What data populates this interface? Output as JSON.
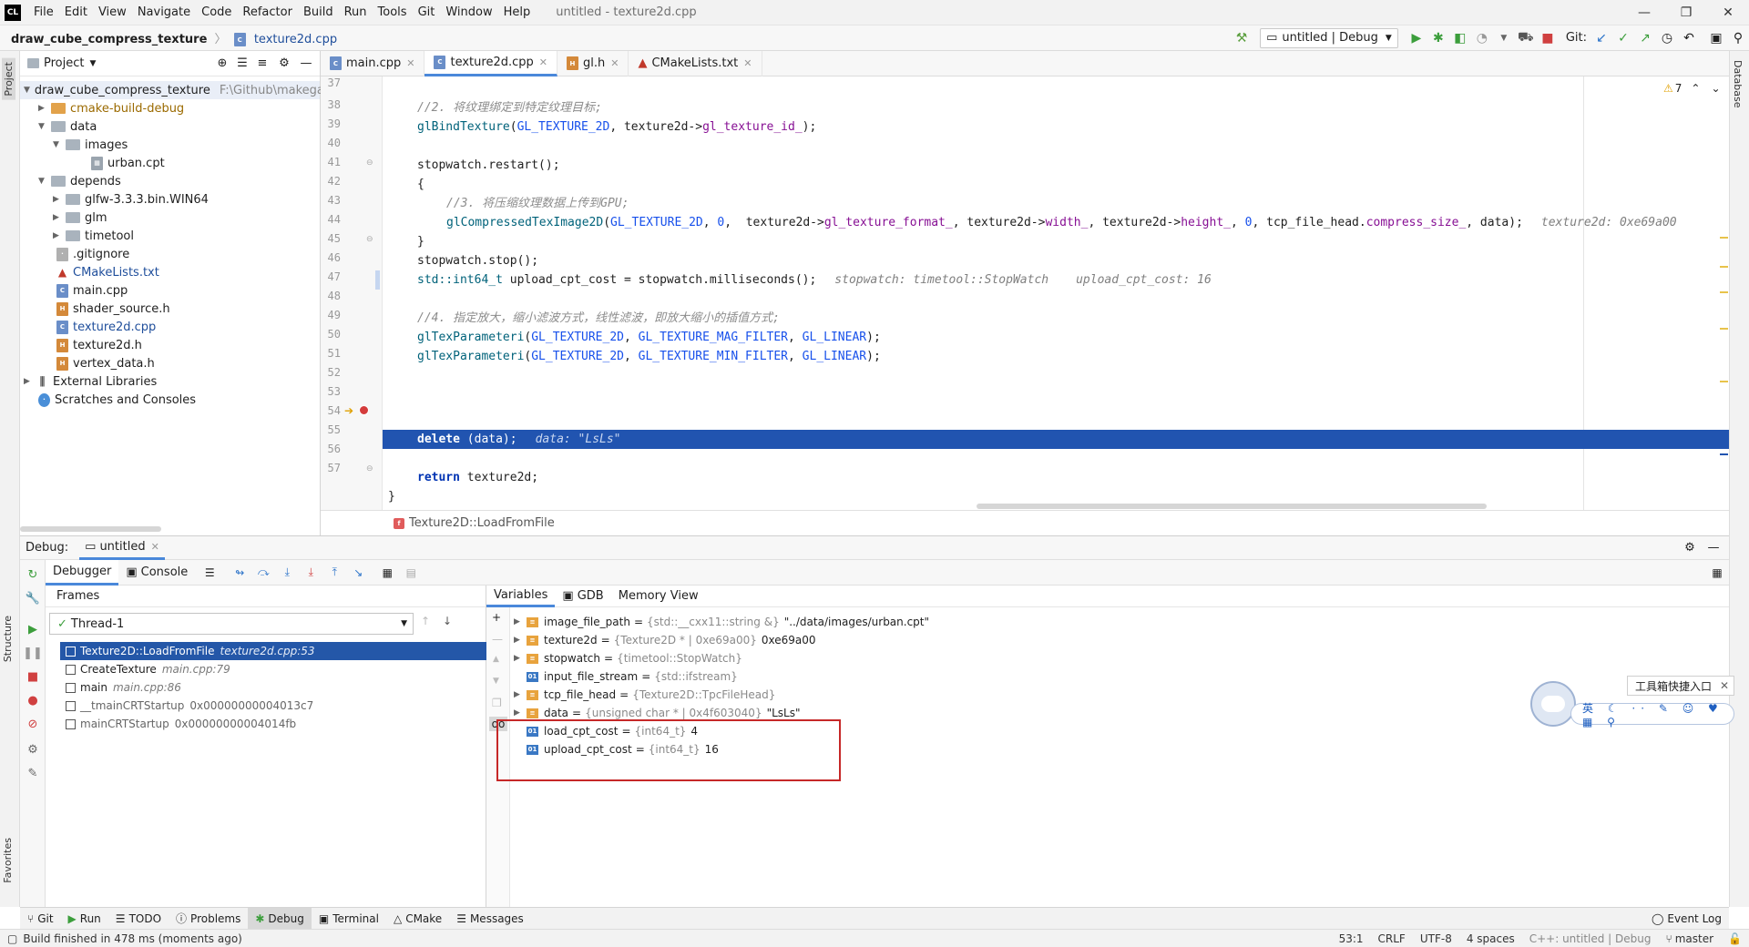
{
  "titlebar": {
    "menus": [
      "File",
      "Edit",
      "View",
      "Navigate",
      "Code",
      "Refactor",
      "Build",
      "Run",
      "Tools",
      "Git",
      "Window",
      "Help"
    ],
    "window_title": "untitled - texture2d.cpp",
    "logo_text": "CL"
  },
  "navbar": {
    "project": "draw_cube_compress_texture",
    "file": "texture2d.cpp",
    "run_config": "untitled | Debug",
    "git_label": "Git:"
  },
  "left_strip": {
    "project_tab": "Project",
    "structure_tab": "Structure",
    "favorites_tab": "Favorites"
  },
  "right_strip": {
    "database_tab": "Database"
  },
  "project_panel": {
    "title": "Project",
    "root": {
      "name": "draw_cube_compress_texture",
      "path": "F:\\Github\\makegam"
    },
    "items": [
      {
        "label": "cmake-build-debug"
      },
      {
        "label": "data"
      },
      {
        "label": "images"
      },
      {
        "label": "urban.cpt"
      },
      {
        "label": "depends"
      },
      {
        "label": "glfw-3.3.3.bin.WIN64"
      },
      {
        "label": "glm"
      },
      {
        "label": "timetool"
      },
      {
        "label": ".gitignore"
      },
      {
        "label": "CMakeLists.txt"
      },
      {
        "label": "main.cpp"
      },
      {
        "label": "shader_source.h"
      },
      {
        "label": "texture2d.cpp"
      },
      {
        "label": "texture2d.h"
      },
      {
        "label": "vertex_data.h"
      },
      {
        "label": "External Libraries"
      },
      {
        "label": "Scratches and Consoles"
      }
    ]
  },
  "editor": {
    "tabs": [
      {
        "label": "main.cpp"
      },
      {
        "label": "texture2d.cpp"
      },
      {
        "label": "gl.h"
      },
      {
        "label": "CMakeLists.txt"
      }
    ],
    "warning_count": "7",
    "line_numbers": [
      "37",
      "38",
      "39",
      "40",
      "41",
      "42",
      "43",
      "44",
      "45",
      "46",
      "47",
      "48",
      "49",
      "50",
      "51",
      "52",
      "53",
      "54",
      "55",
      "56",
      "57"
    ],
    "code": {
      "l38": "//2. 将纹理绑定到特定纹理目标;",
      "l39a": "glBindTexture",
      "l39b": "(",
      "l39c": "GL_TEXTURE_2D",
      "l39d": ", texture2d->",
      "l39e": "gl_texture_id_",
      "l39f": ");",
      "l41": "stopwatch.restart();",
      "l42": "{",
      "l43": "//3. 将压缩纹理数据上传到GPU;",
      "l44a": "glCompressedTexImage2D",
      "l44b": "(",
      "l44c": "GL_TEXTURE_2D",
      "l44d": ", ",
      "l44e": "0",
      "l44f": ",  texture2d->",
      "l44g": "gl_texture_format_",
      "l44h": ", texture2d->",
      "l44i": "width_",
      "l44j": ", texture2d->",
      "l44k": "height_",
      "l44l": ", ",
      "l44m": "0",
      "l44n": ", tcp_file_head.",
      "l44o": "compress_size_",
      "l44p": ", data);",
      "l44hint": "texture2d: 0xe69a00",
      "l45": "}",
      "l46": "stopwatch.stop();",
      "l47a": "std::int64_t",
      "l47b": " upload_cpt_cost = stopwatch.milliseconds();",
      "l47hint1": "stopwatch: timetool::StopWatch",
      "l47hint2": "upload_cpt_cost: 16",
      "l49": "//4. 指定放大，缩小滤波方式，线性滤波，即放大缩小的插值方式;",
      "l50a": "glTexParameteri",
      "l50b": "(",
      "l50c": "GL_TEXTURE_2D",
      "l50d": ", ",
      "l50e": "GL_TEXTURE_MAG_FILTER",
      "l50f": ", ",
      "l50g": "GL_LINEAR",
      "l50h": ");",
      "l51a": "glTexParameteri",
      "l51b": "(",
      "l51c": "GL_TEXTURE_2D",
      "l51d": ", ",
      "l51e": "GL_TEXTURE_MIN_FILTER",
      "l51f": ", ",
      "l51g": "GL_LINEAR",
      "l51h": ");",
      "l53a": "delete",
      "l53b": " (data);",
      "l53hint": "data: \"LsLs\"",
      "l55a": "return",
      "l55b": " texture2d;",
      "l56": "}"
    },
    "breadcrumb": "Texture2D::LoadFromFile"
  },
  "debug": {
    "label": "Debug:",
    "session": "untitled",
    "tabs": {
      "debugger": "Debugger",
      "console": "Console"
    },
    "frames_title": "Frames",
    "thread": "Thread-1",
    "frames": [
      {
        "name": "Texture2D::LoadFromFile",
        "loc": "texture2d.cpp:53"
      },
      {
        "name": "CreateTexture",
        "loc": "main.cpp:79"
      },
      {
        "name": "main",
        "loc": "main.cpp:86"
      },
      {
        "name": "__tmainCRTStartup",
        "loc": "0x00000000004013c7"
      },
      {
        "name": "mainCRTStartup",
        "loc": "0x00000000004014fb"
      }
    ],
    "var_tabs": {
      "variables": "Variables",
      "gdb": "GDB",
      "memory": "Memory View"
    },
    "variables": [
      {
        "name": "image_file_path",
        "type": "{std::__cxx11::string &}",
        "value": "\"../data/images/urban.cpt\""
      },
      {
        "name": "texture2d",
        "type": "{Texture2D * | 0xe69a00}",
        "value": "0xe69a00"
      },
      {
        "name": "stopwatch",
        "type": "{timetool::StopWatch}",
        "value": ""
      },
      {
        "name": "input_file_stream",
        "type": "{std::ifstream}",
        "value": ""
      },
      {
        "name": "tcp_file_head",
        "type": "{Texture2D::TpcFileHead}",
        "value": ""
      },
      {
        "name": "data",
        "type": "{unsigned char * | 0x4f603040}",
        "value": "\"LsLs\""
      },
      {
        "name": "load_cpt_cost",
        "type": "{int64_t}",
        "value": "4"
      },
      {
        "name": "upload_cpt_cost",
        "type": "{int64_t}",
        "value": "16"
      }
    ]
  },
  "bottom_tools": [
    "Git",
    "Run",
    "TODO",
    "Problems",
    "Debug",
    "Terminal",
    "CMake",
    "Messages"
  ],
  "event_log": "Event Log",
  "status": {
    "message": "Build finished in 478 ms (moments ago)",
    "position": "53:1",
    "line_sep": "CRLF",
    "encoding": "UTF-8",
    "indent": "4 spaces",
    "context": "C++: untitled | Debug",
    "branch": "master"
  },
  "ime": {
    "tip": "工具箱快捷入口",
    "bar": "英 ☾ ·· ✎ ☺ ♥ ▦ ⚲"
  }
}
